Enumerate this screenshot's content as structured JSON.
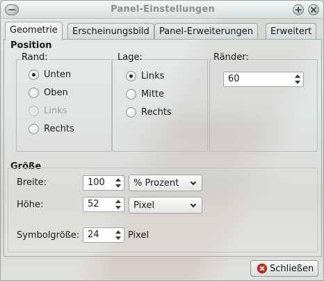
{
  "window": {
    "title": "Panel-Einstellungen"
  },
  "tabs": [
    {
      "label": "Geometrie"
    },
    {
      "label": "Erscheinungsbild"
    },
    {
      "label": "Panel-Erweiterungen"
    },
    {
      "label": "Erweitert"
    }
  ],
  "position": {
    "title": "Position",
    "rand": {
      "label": "Rand:",
      "options": [
        {
          "label": "Unten",
          "checked": true
        },
        {
          "label": "Oben"
        },
        {
          "label": "Links",
          "disabled": true
        },
        {
          "label": "Rechts"
        }
      ]
    },
    "lage": {
      "label": "Lage:",
      "options": [
        {
          "label": "Links",
          "checked": true
        },
        {
          "label": "Mitte"
        },
        {
          "label": "Rechts"
        }
      ]
    },
    "raender": {
      "label": "Ränder:",
      "value": "60"
    }
  },
  "groesse": {
    "title": "Größe",
    "breite": {
      "label": "Breite:",
      "value": "100",
      "unit": "% Prozent"
    },
    "hoehe": {
      "label": "Höhe:",
      "value": "52",
      "unit": "Pixel"
    },
    "symbol": {
      "label": "Symbolgröße:",
      "value": "24",
      "unit": "Pixel"
    }
  },
  "footer": {
    "close_label": "Schließen"
  }
}
